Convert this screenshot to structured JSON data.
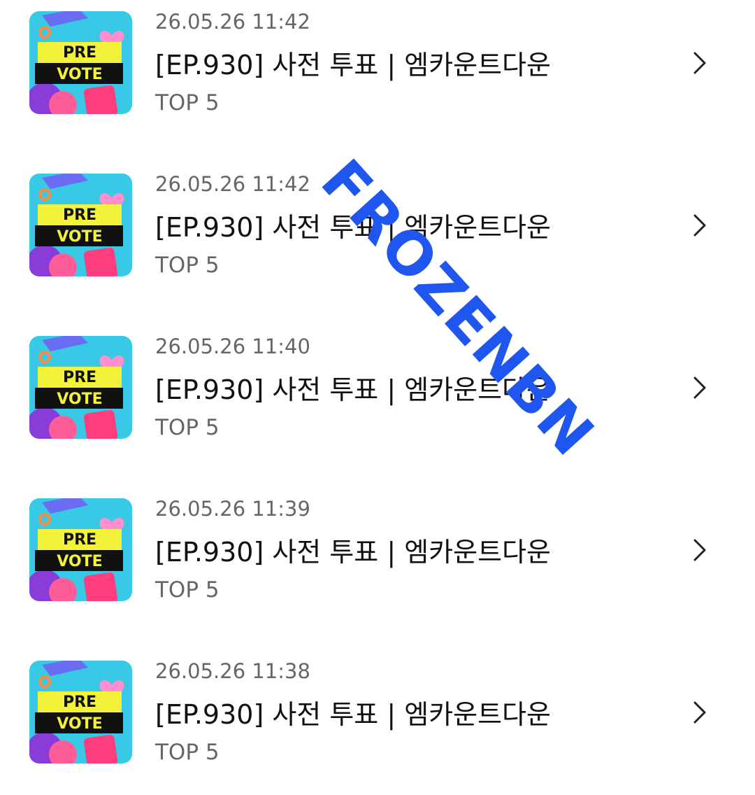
{
  "thumbnail": {
    "icon": "pre-vote-image",
    "line1": "PRE",
    "line2": "VOTE"
  },
  "items": [
    {
      "date": "26.05.26 11:42",
      "title": "[EP.930] 사전 투표 | 엠카운트다운",
      "sub": "TOP 5"
    },
    {
      "date": "26.05.26 11:42",
      "title": "[EP.930] 사전 투표 | 엠카운트다운",
      "sub": "TOP 5"
    },
    {
      "date": "26.05.26 11:40",
      "title": "[EP.930] 사전 투표 | 엠카운트다운",
      "sub": "TOP 5"
    },
    {
      "date": "26.05.26 11:39",
      "title": "[EP.930] 사전 투표 | 엠카운트다운",
      "sub": "TOP 5"
    },
    {
      "date": "26.05.26 11:38",
      "title": "[EP.930] 사전 투표 | 엠카운트다운",
      "sub": "TOP 5"
    }
  ],
  "watermark": "FROZENBN",
  "colors": {
    "watermark": "#1f56f0",
    "thumb_bg": "#37c9e6",
    "thumb_banner": "#f2f23a"
  }
}
